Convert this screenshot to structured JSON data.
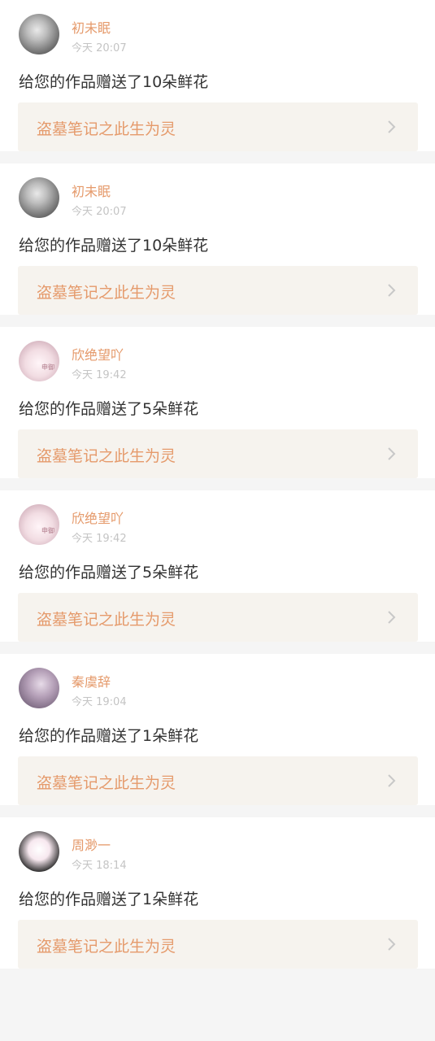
{
  "notifications": [
    {
      "name": "初未眠",
      "time": "今天 20:07",
      "message": "给您的作品赠送了10朵鲜花",
      "work": "盗墓笔记之此生为灵",
      "avatar_icon": "avatar-gray-icon"
    },
    {
      "name": "初未眠",
      "time": "今天 20:07",
      "message": "给您的作品赠送了10朵鲜花",
      "work": "盗墓笔记之此生为灵",
      "avatar_icon": "avatar-gray-icon"
    },
    {
      "name": "欣绝望吖",
      "time": "今天 19:42",
      "message": "给您的作品赠送了5朵鲜花",
      "work": "盗墓笔记之此生为灵",
      "avatar_icon": "avatar-cat-icon",
      "avatar_badge": "申御"
    },
    {
      "name": "欣绝望吖",
      "time": "今天 19:42",
      "message": "给您的作品赠送了5朵鲜花",
      "work": "盗墓笔记之此生为灵",
      "avatar_icon": "avatar-cat-icon",
      "avatar_badge": "申御"
    },
    {
      "name": "秦虞辞",
      "time": "今天 19:04",
      "message": "给您的作品赠送了1朵鲜花",
      "work": "盗墓笔记之此生为灵",
      "avatar_icon": "avatar-purple-icon"
    },
    {
      "name": "周渺一",
      "time": "今天 18:14",
      "message": "给您的作品赠送了1朵鲜花",
      "work": "盗墓笔记之此生为灵",
      "avatar_icon": "avatar-girl-icon"
    }
  ],
  "colors": {
    "accent": "#e59a6b",
    "text": "#333333",
    "muted": "#c4c4c4",
    "card_bg": "#f6f3ee",
    "page_bg": "#f5f5f5"
  }
}
